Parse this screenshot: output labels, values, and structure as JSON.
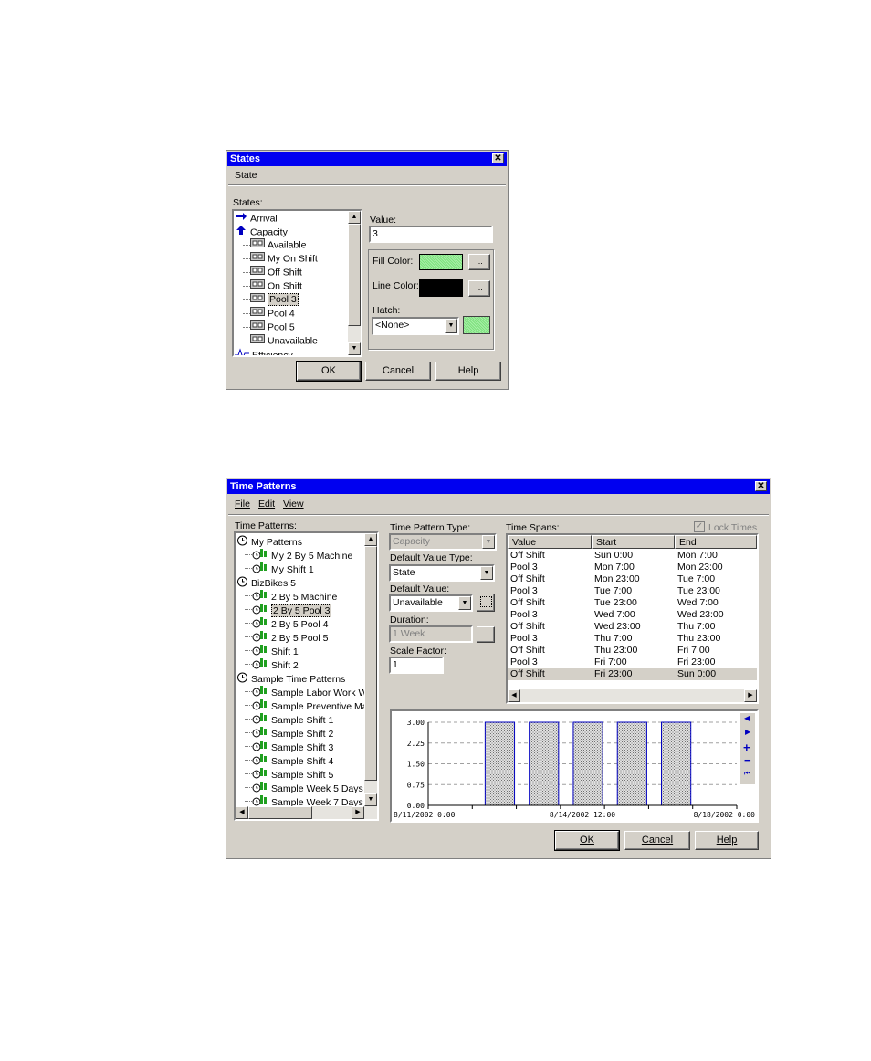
{
  "states_dialog": {
    "title": "States",
    "menu_state": "State",
    "states_label": "States:",
    "tree": [
      {
        "label": "Arrival",
        "level": 0,
        "icon": "arrow-right-icon"
      },
      {
        "label": "Capacity",
        "level": 0,
        "icon": "arrow-up-icon"
      },
      {
        "label": "Available",
        "level": 1,
        "icon": "state-icon"
      },
      {
        "label": "My On Shift",
        "level": 1,
        "icon": "state-icon"
      },
      {
        "label": "Off Shift",
        "level": 1,
        "icon": "state-icon"
      },
      {
        "label": "On Shift",
        "level": 1,
        "icon": "state-icon"
      },
      {
        "label": "Pool 3",
        "level": 1,
        "icon": "state-icon",
        "selected": true
      },
      {
        "label": "Pool 4",
        "level": 1,
        "icon": "state-icon"
      },
      {
        "label": "Pool 5",
        "level": 1,
        "icon": "state-icon"
      },
      {
        "label": "Unavailable",
        "level": 1,
        "icon": "state-icon"
      },
      {
        "label": "Efficiency",
        "level": 0,
        "icon": "efficiency-icon"
      }
    ],
    "value_label": "Value:",
    "value": "3",
    "fill_color_label": "Fill Color:",
    "line_color_label": "Line Color:",
    "hatch_label": "Hatch:",
    "hatch_value": "<None>",
    "browse_label": "...",
    "fill_color": "#7ee07e",
    "line_color": "#000000",
    "ok": "OK",
    "cancel": "Cancel",
    "help": "Help"
  },
  "time_patterns_dialog": {
    "title": "Time Patterns",
    "menu": [
      "File",
      "Edit",
      "View"
    ],
    "patterns_label": "Time Patterns:",
    "tree": [
      {
        "label": "My Patterns",
        "level": 0,
        "icon": "clock-icon"
      },
      {
        "label": "My 2 By 5 Machine",
        "level": 1,
        "icon": "pattern-icon"
      },
      {
        "label": "My Shift 1",
        "level": 1,
        "icon": "pattern-icon"
      },
      {
        "label": "BizBikes 5",
        "level": 0,
        "icon": "clock-icon"
      },
      {
        "label": "2 By 5 Machine",
        "level": 1,
        "icon": "pattern-icon"
      },
      {
        "label": "2 By 5 Pool 3",
        "level": 1,
        "icon": "pattern-icon",
        "selected": true
      },
      {
        "label": "2 By 5 Pool 4",
        "level": 1,
        "icon": "pattern-icon"
      },
      {
        "label": "2 By 5 Pool 5",
        "level": 1,
        "icon": "pattern-icon"
      },
      {
        "label": "Shift 1",
        "level": 1,
        "icon": "pattern-icon"
      },
      {
        "label": "Shift 2",
        "level": 1,
        "icon": "pattern-icon"
      },
      {
        "label": "Sample Time Patterns",
        "level": 0,
        "icon": "clock-icon"
      },
      {
        "label": "Sample Labor Work Wc",
        "level": 1,
        "icon": "pattern-icon"
      },
      {
        "label": "Sample Preventive Main",
        "level": 1,
        "icon": "pattern-icon"
      },
      {
        "label": "Sample Shift 1",
        "level": 1,
        "icon": "pattern-icon"
      },
      {
        "label": "Sample Shift 2",
        "level": 1,
        "icon": "pattern-icon"
      },
      {
        "label": "Sample Shift 3",
        "level": 1,
        "icon": "pattern-icon"
      },
      {
        "label": "Sample Shift 4",
        "level": 1,
        "icon": "pattern-icon"
      },
      {
        "label": "Sample Shift 5",
        "level": 1,
        "icon": "pattern-icon"
      },
      {
        "label": "Sample Week 5 Days",
        "level": 1,
        "icon": "pattern-icon"
      },
      {
        "label": "Sample Week 7 Days",
        "level": 1,
        "icon": "pattern-icon"
      }
    ],
    "type_label": "Time Pattern Type:",
    "type_value": "Capacity",
    "default_type_label": "Default Value Type:",
    "default_type_value": "State",
    "default_value_label": "Default Value:",
    "default_value": "Unavailable",
    "duration_label": "Duration:",
    "duration_value": "1 Week",
    "scale_label": "Scale Factor:",
    "scale_value": "1",
    "spans_label": "Time Spans:",
    "lock_times": "Lock Times",
    "columns": [
      "Value",
      "Start",
      "End"
    ],
    "rows": [
      [
        "Off Shift",
        "Sun 0:00",
        "Mon 7:00"
      ],
      [
        "Pool 3",
        "Mon 7:00",
        "Mon 23:00"
      ],
      [
        "Off Shift",
        "Mon 23:00",
        "Tue 7:00"
      ],
      [
        "Pool 3",
        "Tue 7:00",
        "Tue 23:00"
      ],
      [
        "Off Shift",
        "Tue 23:00",
        "Wed 7:00"
      ],
      [
        "Pool 3",
        "Wed 7:00",
        "Wed 23:00"
      ],
      [
        "Off Shift",
        "Wed 23:00",
        "Thu 7:00"
      ],
      [
        "Pool 3",
        "Thu 7:00",
        "Thu 23:00"
      ],
      [
        "Off Shift",
        "Thu 23:00",
        "Fri 7:00"
      ],
      [
        "Pool 3",
        "Fri 7:00",
        "Fri 23:00"
      ],
      [
        "Off Shift",
        "Fri 23:00",
        "Sun 0:00"
      ]
    ],
    "ok": "OK",
    "cancel": "Cancel",
    "help": "Help"
  },
  "chart_data": {
    "type": "bar",
    "y_ticks": [
      "3.00",
      "2.25",
      "1.50",
      "0.75",
      "0.00"
    ],
    "x_ticks": [
      "8/11/2002 0:00",
      "8/14/2002 12:00",
      "8/18/2002 0:00"
    ],
    "ylim": [
      0,
      3
    ],
    "xlim_hours": [
      0,
      168
    ],
    "bars": [
      {
        "start": 31,
        "end": 47,
        "value": 3
      },
      {
        "start": 55,
        "end": 71,
        "value": 3
      },
      {
        "start": 79,
        "end": 95,
        "value": 3
      },
      {
        "start": 103,
        "end": 119,
        "value": 3
      },
      {
        "start": 127,
        "end": 143,
        "value": 3
      }
    ],
    "bar_color": "#b8b8b8",
    "bar_edge": "#0000c0"
  }
}
